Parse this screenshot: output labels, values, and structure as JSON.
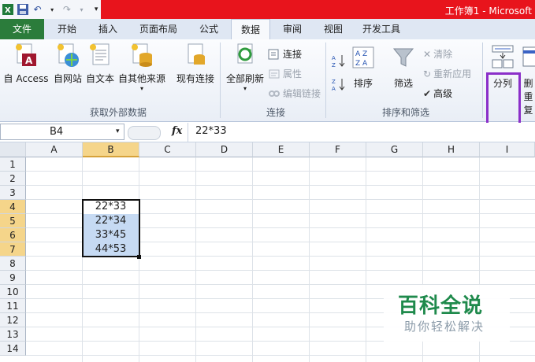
{
  "title_bar": {
    "window_title": "工作簿1 - Microsoft"
  },
  "qat": {
    "excel_icon": "excel-icon",
    "save_icon": "save-icon",
    "undo_icon": "undo-icon",
    "redo_icon": "redo-icon",
    "customize_icon": "customize-icon"
  },
  "tabs": [
    {
      "label": "文件"
    },
    {
      "label": "开始"
    },
    {
      "label": "插入"
    },
    {
      "label": "页面布局"
    },
    {
      "label": "公式"
    },
    {
      "label": "数据"
    },
    {
      "label": "审阅"
    },
    {
      "label": "视图"
    },
    {
      "label": "开发工具"
    }
  ],
  "ribbon": {
    "get_external": {
      "group_label": "获取外部数据",
      "access": "自 Access",
      "web": "自网站",
      "text": "自文本",
      "other": "自其他来源",
      "existing": "现有连接"
    },
    "connections": {
      "group_label": "连接",
      "refresh_all": "全部刷新",
      "connections": "连接",
      "properties": "属性",
      "edit_links": "编辑链接"
    },
    "sort_filter": {
      "group_label": "排序和筛选",
      "sort": "排序",
      "filter": "筛选",
      "clear": "清除",
      "reapply": "重新应用",
      "advanced": "高级"
    },
    "data_tools": {
      "text_to_columns": "分列",
      "remove_dup_partial": "删",
      "remove_dup_partial2": "重复"
    }
  },
  "formula_bar": {
    "name_box": "B4",
    "fx": "fx",
    "content": "22*33"
  },
  "sheet": {
    "columns": [
      "A",
      "B",
      "C",
      "D",
      "E",
      "F",
      "G",
      "H",
      "I"
    ],
    "rows": [
      "1",
      "2",
      "3",
      "4",
      "5",
      "6",
      "7",
      "8",
      "9",
      "10",
      "11",
      "12",
      "13",
      "14"
    ],
    "cells": [
      {
        "ref": "B4",
        "value": "22*33"
      },
      {
        "ref": "B5",
        "value": "22*34"
      },
      {
        "ref": "B6",
        "value": "33*45"
      },
      {
        "ref": "B7",
        "value": "44*53"
      }
    ]
  },
  "watermark": {
    "line1": "百科全说",
    "line2": "助你轻松解决"
  },
  "colors": {
    "file_tab": "#2b7c3b",
    "title_red": "#e8141c",
    "highlight": "#8b2fc9",
    "selection_fill": "#c6daf3"
  }
}
